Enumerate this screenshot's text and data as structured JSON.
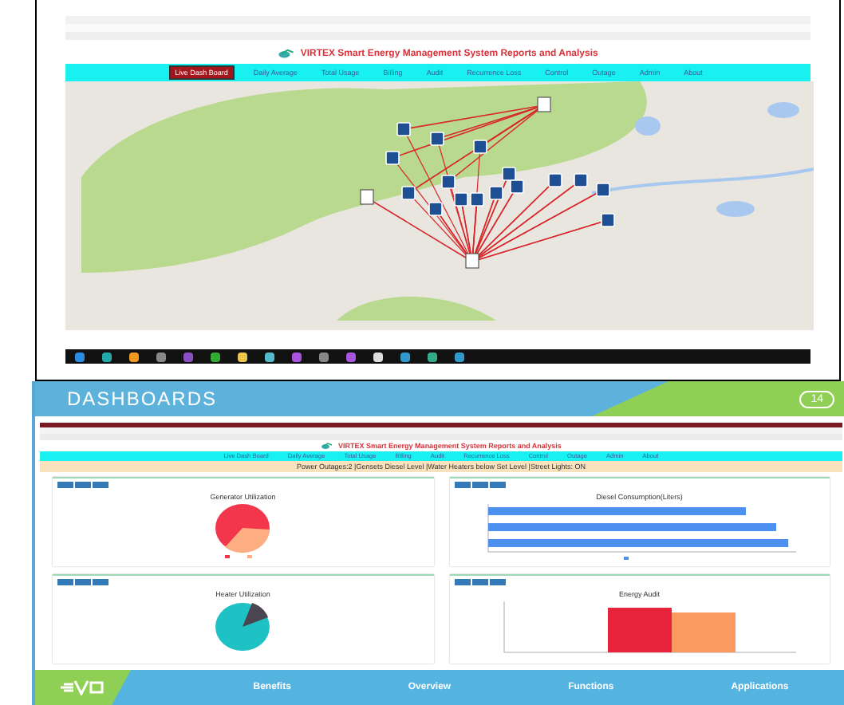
{
  "browser": {
    "page_title": "VIRTEX Smart Energy Management System Reports and Analysis",
    "nav": [
      {
        "label": "Live Dash Board",
        "selected": true
      },
      {
        "label": "Daily Average",
        "selected": false
      },
      {
        "label": "Total Usage",
        "selected": false
      },
      {
        "label": "Billing",
        "selected": false
      },
      {
        "label": "Audit",
        "selected": false
      },
      {
        "label": "Recurrence Loss",
        "selected": false
      },
      {
        "label": "Control",
        "selected": false
      },
      {
        "label": "Outage",
        "selected": false
      },
      {
        "label": "Admin",
        "selected": false
      },
      {
        "label": "About",
        "selected": false
      }
    ]
  },
  "slide": {
    "title": "DASHBOARDS",
    "page_number": "14",
    "app": {
      "page_title": "VIRTEX Smart Energy Management System Reports and Analysis",
      "nav": [
        {
          "label": "Live Dash Board",
          "selected": false
        },
        {
          "label": "Daily Average",
          "selected": false
        },
        {
          "label": "Total Usage",
          "selected": false
        },
        {
          "label": "Billing",
          "selected": false
        },
        {
          "label": "Audit",
          "selected": false
        },
        {
          "label": "Recurrence Loss",
          "selected": false
        },
        {
          "label": "Control",
          "selected": false
        },
        {
          "label": "Outage",
          "selected": false
        },
        {
          "label": "Admin",
          "selected": false
        },
        {
          "label": "About",
          "selected": false
        }
      ],
      "alert": "Power Outages:2 |Gensets Diesel Level |Water Heaters below Set Level |Street Lights: ON",
      "panels": [
        {
          "title": "Generator Utilization",
          "kind": "pie"
        },
        {
          "title": "Diesel Consumption(Liters)",
          "kind": "hbar"
        },
        {
          "title": "Heater Utilization",
          "kind": "pie2"
        },
        {
          "title": "Energy Audit",
          "kind": "vbar"
        }
      ]
    },
    "footer_links": [
      "Benefits",
      "Overview",
      "Functions",
      "Applications"
    ]
  }
}
